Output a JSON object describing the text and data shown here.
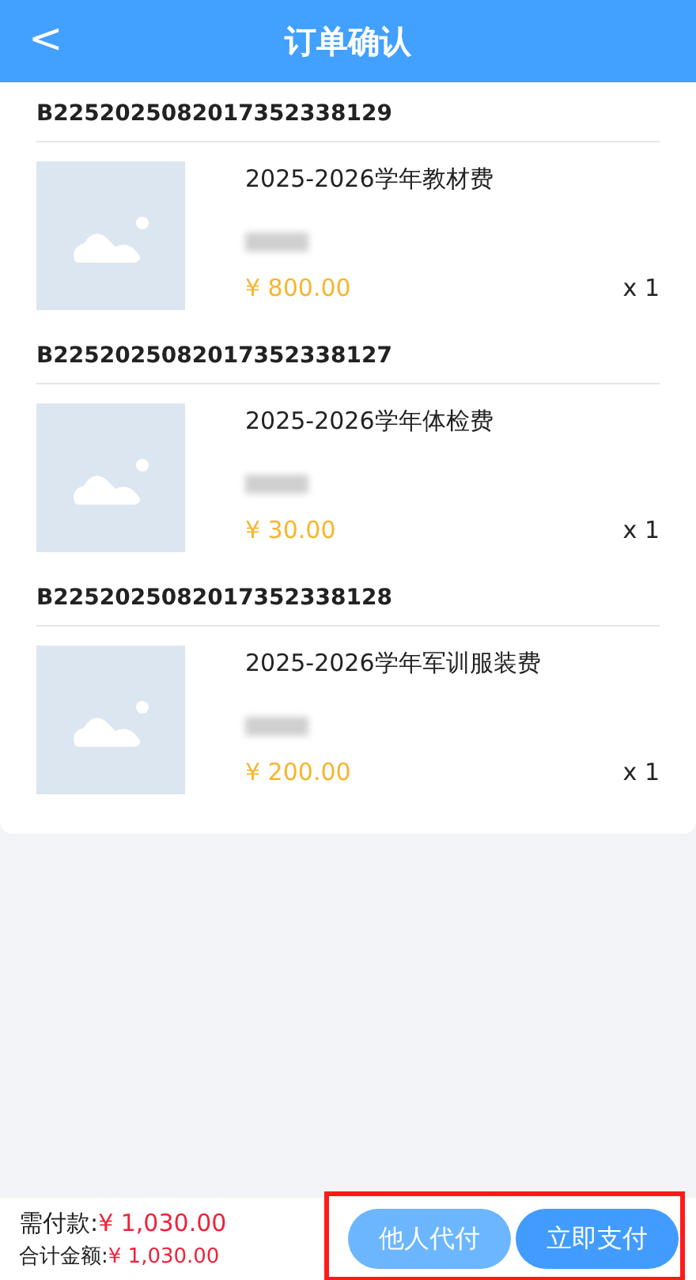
{
  "header": {
    "back_icon": "<",
    "title": "订单确认"
  },
  "orders": [
    {
      "order_no": "B2252025082017352338129",
      "item": {
        "title": "2025-2026学年教材费",
        "detail_blurred": true,
        "price": "¥ 800.00",
        "quantity": "x 1"
      }
    },
    {
      "order_no": "B2252025082017352338127",
      "item": {
        "title": "2025-2026学年体检费",
        "detail_blurred": true,
        "price": "¥ 30.00",
        "quantity": "x 1"
      }
    },
    {
      "order_no": "B2252025082017352338128",
      "item": {
        "title": "2025-2026学年军训服装费",
        "detail_blurred": true,
        "price": "¥ 200.00",
        "quantity": "x 1"
      }
    }
  ],
  "footer": {
    "payable_label": "需付款:",
    "payable_amount": "¥ 1,030.00",
    "total_label": "合计金额:",
    "total_amount": "¥ 1,030.00",
    "buttons": [
      {
        "label": "他人代付",
        "kind": "secondary"
      },
      {
        "label": "立即支付",
        "kind": "primary"
      }
    ],
    "buttons_highlighted": true
  }
}
